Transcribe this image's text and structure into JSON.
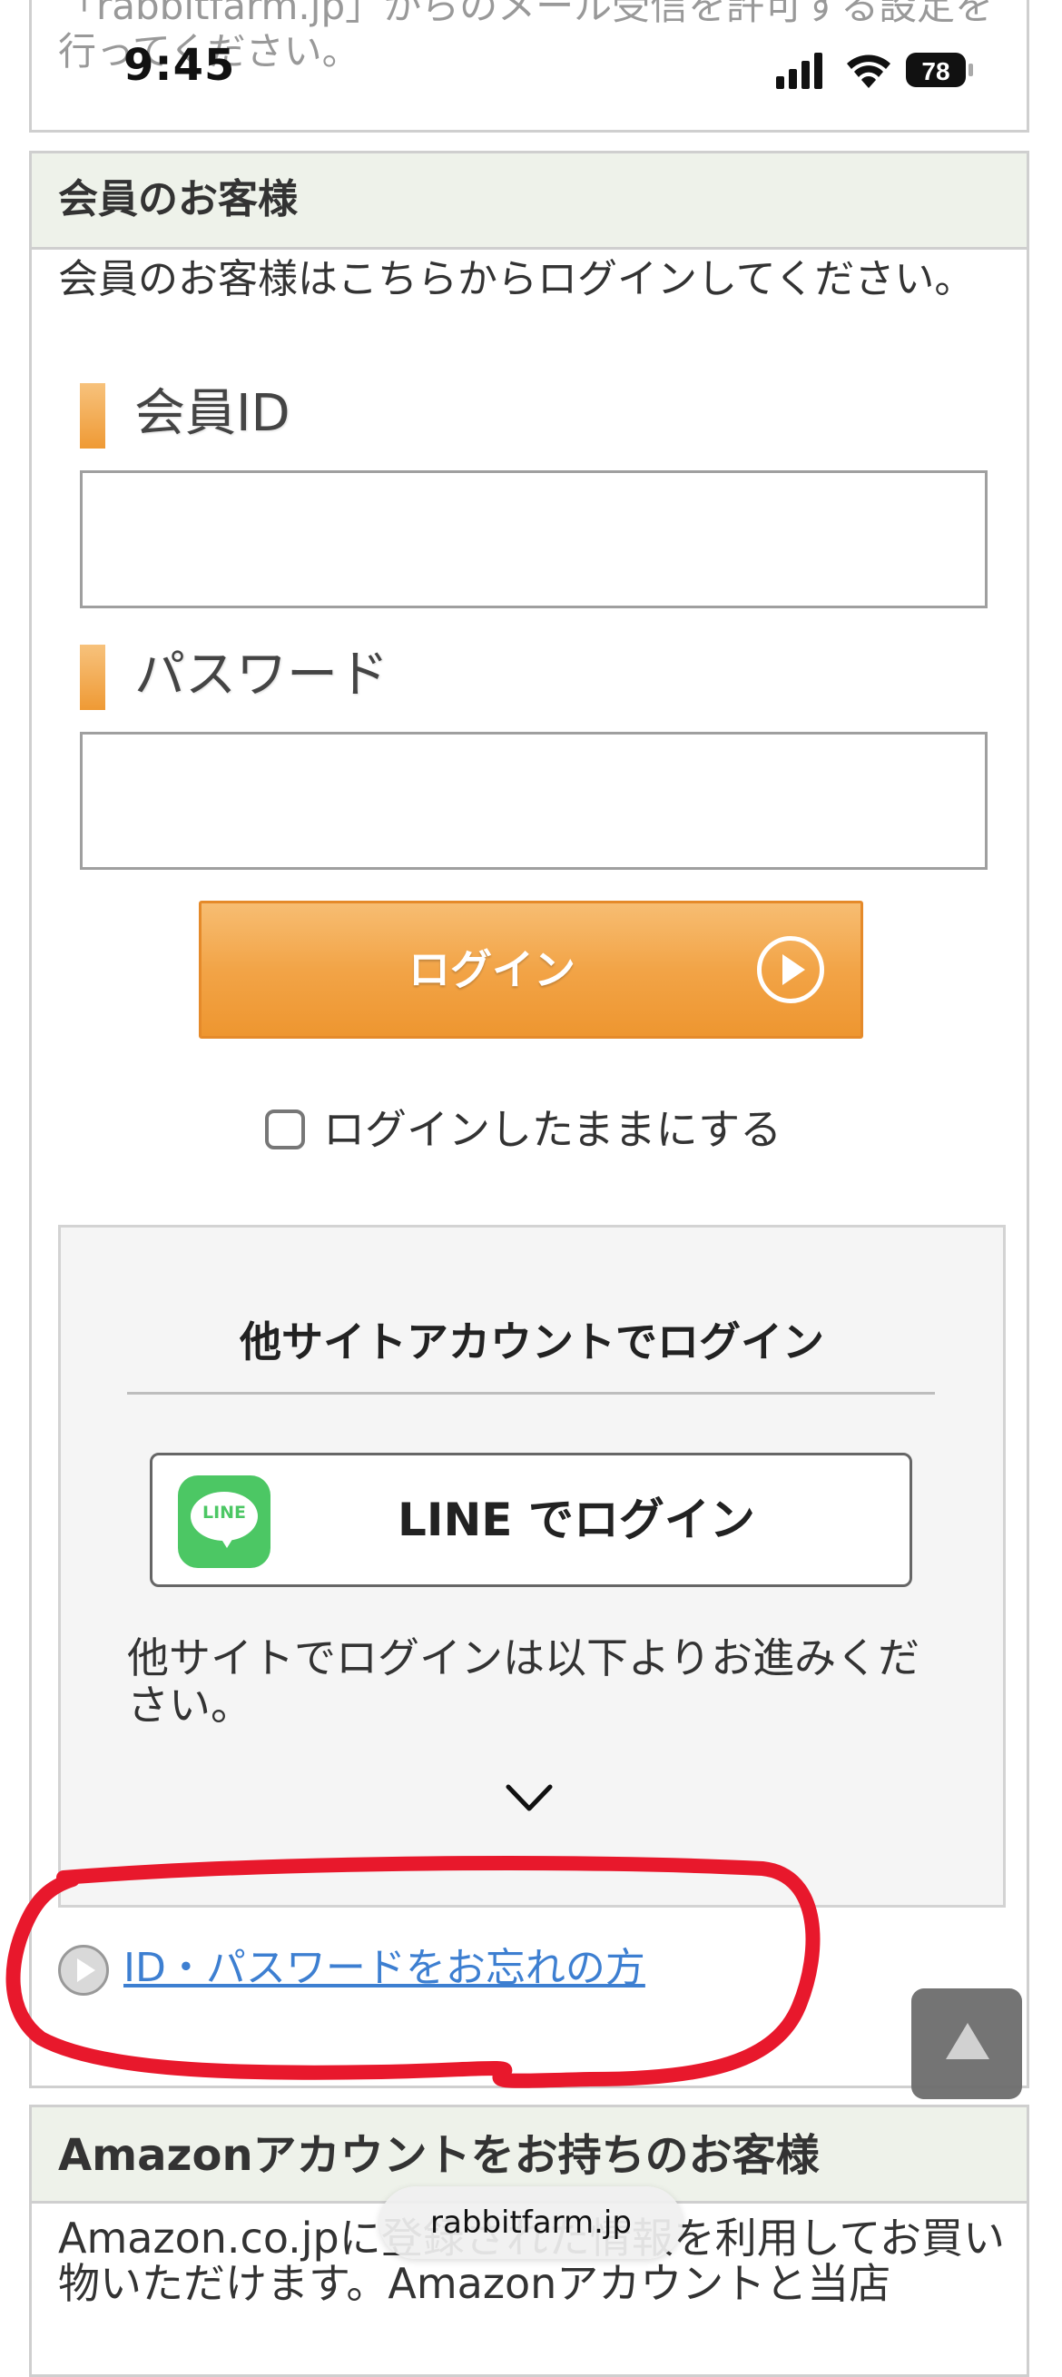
{
  "status_bar": {
    "time": "9:45",
    "battery": "78",
    "icons": [
      "signal-icon",
      "wifi-icon",
      "battery-icon"
    ]
  },
  "top_box": {
    "text": "「rabbitfarm.jp」からのメール受信を許可する設定を行ってください。"
  },
  "member_section": {
    "title": "会員のお客様",
    "intro": "会員のお客様はこちらからログインしてください。",
    "member_id_label": "会員ID",
    "member_id_value": "",
    "password_label": "パスワード",
    "password_value": "",
    "login_button": "ログイン",
    "keep_login_label": "ログインしたままにする",
    "keep_login_checked": false
  },
  "other_login": {
    "title": "他サイトアカウントでログイン",
    "line_logo_text": "LINE",
    "line_button": "LINE でログイン",
    "description": "他サイトでログインは以下よりお進みください。"
  },
  "forgot_link": "ID・パスワードをお忘れの方",
  "amazon_section": {
    "title": "Amazonアカウントをお持ちのお客様",
    "text": "Amazon.co.jpに登録された情報を利用してお買い物いただけます。Amazonアカウントと当店"
  },
  "browser": {
    "url": "rabbitfarm.jp"
  },
  "colors": {
    "accent_orange": "#f2a447",
    "link_blue": "#3d7fd1",
    "line_green": "#4cc764",
    "annotation_red": "#e8182c",
    "header_bg": "#eef2ea"
  }
}
